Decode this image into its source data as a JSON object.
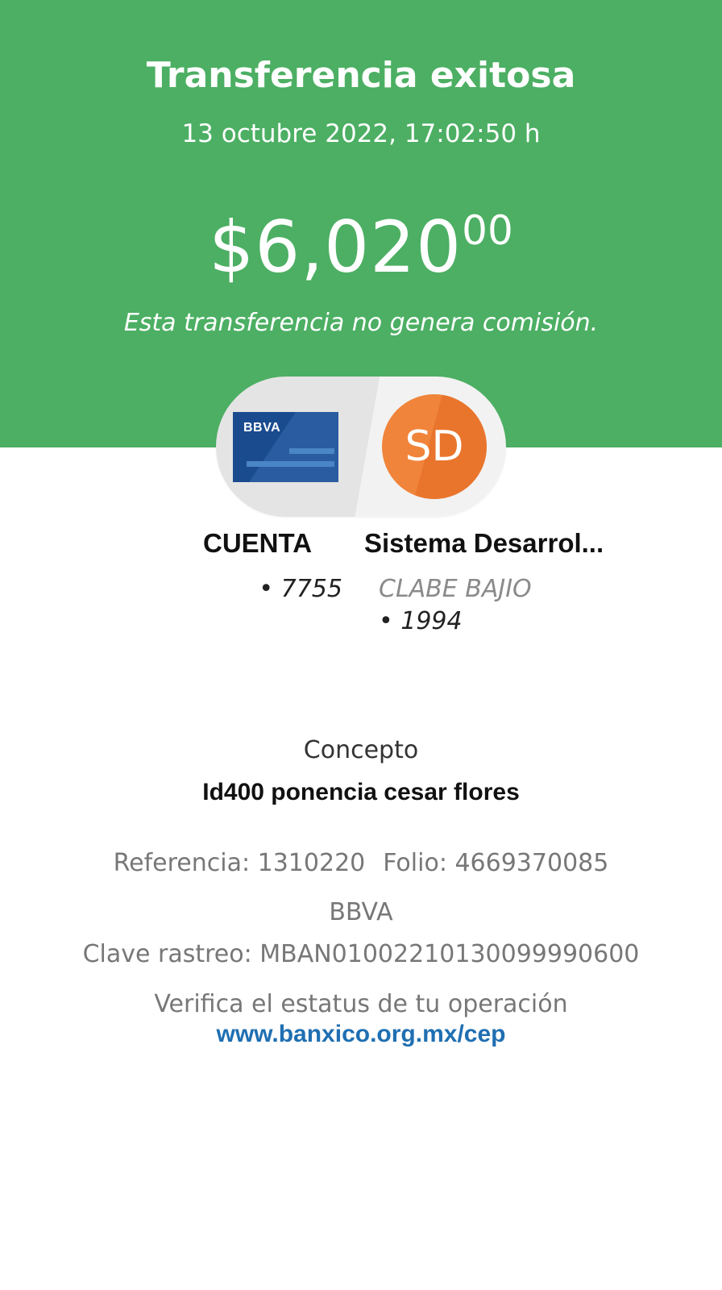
{
  "header": {
    "title": "Transferencia exitosa",
    "datetime": "13 octubre 2022, 17:02:50 h",
    "amount_main": "$6,020",
    "amount_cents": "00",
    "commission_note": "Esta transferencia no genera comisión."
  },
  "origin": {
    "card_logo": "BBVA",
    "account_name": "CUENTA",
    "account_number": "• 7755"
  },
  "destination": {
    "initials": "SD",
    "name": "Sistema Desarrol...",
    "bank": "CLABE BAJIO",
    "number": "• 1994"
  },
  "details": {
    "concept_label": "Concepto",
    "concept_value": "Id400 ponencia cesar flores",
    "reference": "Referencia: 1310220",
    "folio": "Folio: 4669370085",
    "bank": "BBVA",
    "tracking_key": "Clave rastreo: MBAN01002210130099990600",
    "verify_text": "Verifica el estatus de tu operación",
    "verify_link": "www.banxico.org.mx/cep"
  },
  "colors": {
    "header_green": "#4caf63",
    "card_blue": "#1a4b8f",
    "avatar_orange": "#f0843a",
    "link_blue": "#1f6fb2"
  },
  "icons": {
    "origin": "bbva-card-icon",
    "destination": "contact-avatar"
  }
}
